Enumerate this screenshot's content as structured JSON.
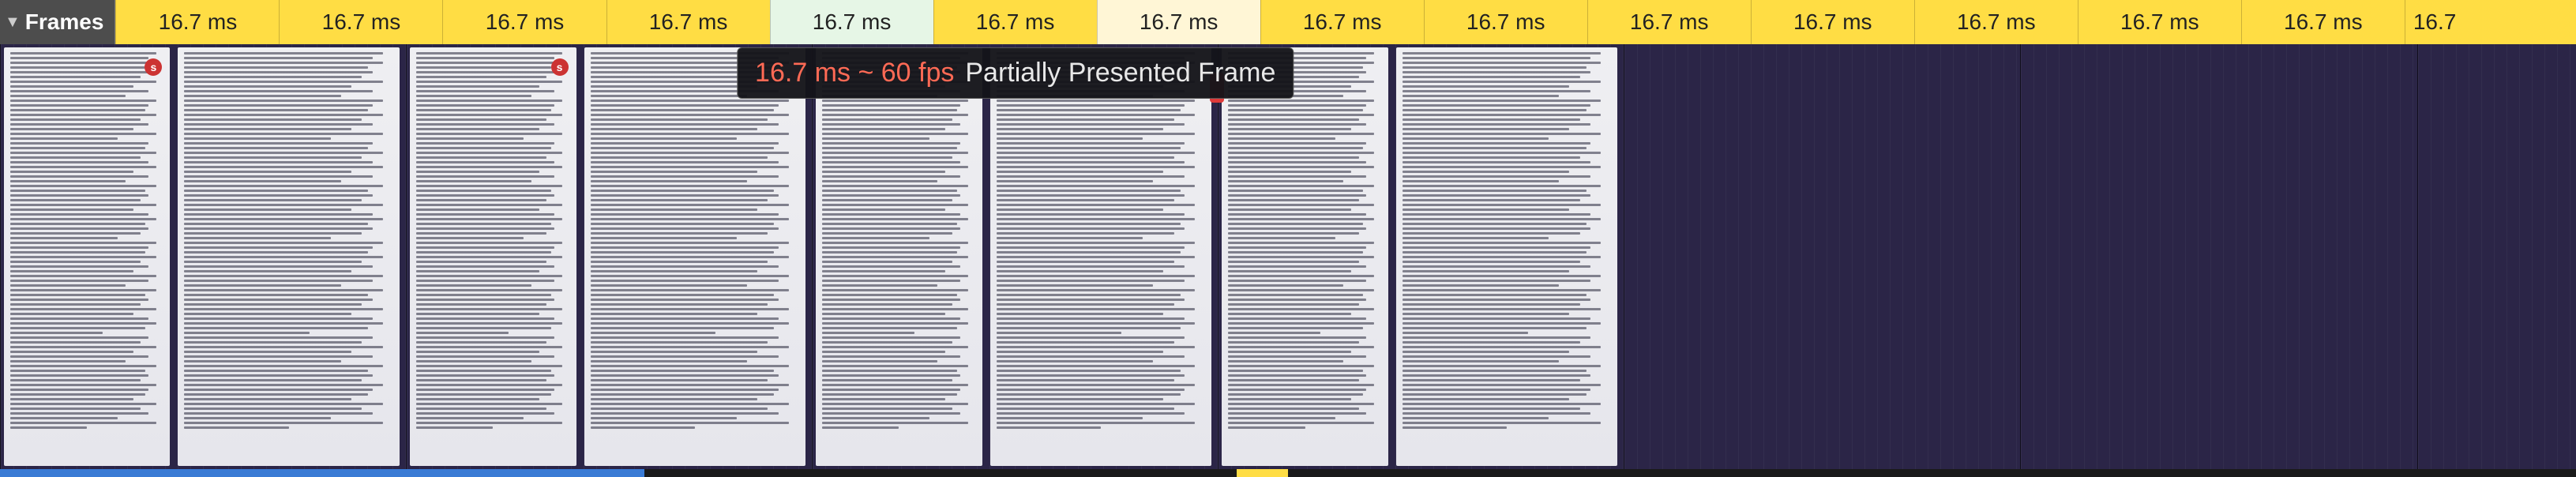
{
  "header": {
    "track_label": "Frames"
  },
  "frames": [
    {
      "label": "16.7 ms",
      "color": "yellow"
    },
    {
      "label": "16.7 ms",
      "color": "yellow"
    },
    {
      "label": "16.7 ms",
      "color": "yellow"
    },
    {
      "label": "16.7 ms",
      "color": "yellow"
    },
    {
      "label": "16.7 ms",
      "color": "light"
    },
    {
      "label": "16.7 ms",
      "color": "yellow"
    },
    {
      "label": "16.7 ms",
      "color": "pale"
    },
    {
      "label": "16.7 ms",
      "color": "yellow"
    },
    {
      "label": "16.7 ms",
      "color": "yellow"
    },
    {
      "label": "16.7 ms",
      "color": "yellow"
    },
    {
      "label": "16.7 ms",
      "color": "yellow"
    },
    {
      "label": "16.7 ms",
      "color": "yellow"
    },
    {
      "label": "16.7 ms",
      "color": "yellow"
    },
    {
      "label": "16.7 ms",
      "color": "yellow"
    },
    {
      "label": "16.7",
      "color": "yellow",
      "truncated": true
    }
  ],
  "tooltip": {
    "time": "16.7 ms ~ 60 fps",
    "label": "Partially Presented Frame"
  },
  "badge_char": "s",
  "footer": [
    {
      "color": "blue",
      "width_pct": 25
    },
    {
      "color": "dark",
      "width_pct": 23
    },
    {
      "color": "yellow",
      "width_pct": 2
    },
    {
      "color": "dark",
      "width_pct": 50
    }
  ]
}
